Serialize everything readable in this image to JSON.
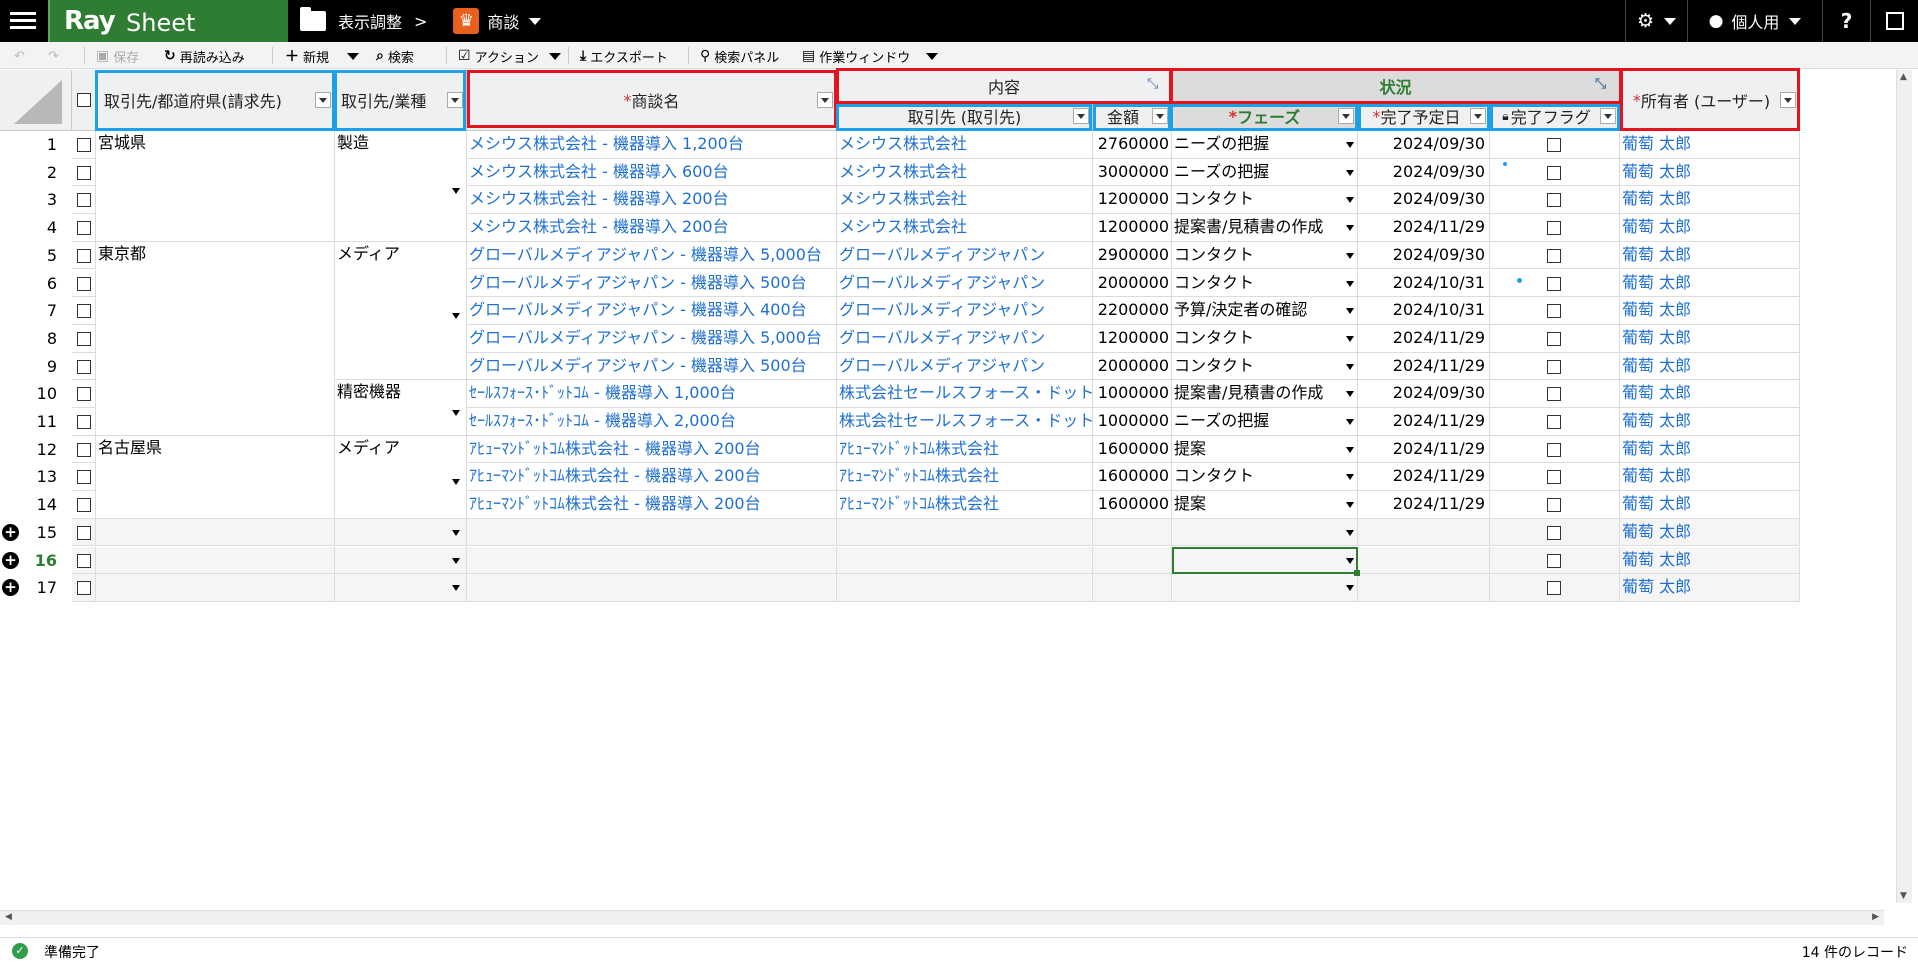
{
  "app": {
    "logo_main": "Ray",
    "logo_sub": "Sheet"
  },
  "breadcrumb": {
    "folder": "表示調整",
    "separator": ">",
    "page": "商談"
  },
  "topbar": {
    "user_label": "個人用",
    "help_label": "?"
  },
  "toolbar": {
    "save": "保存",
    "reload": "再読み込み",
    "new": "新規",
    "search": "検索",
    "action": "アクション",
    "export": "エクスポート",
    "search_panel": "検索パネル",
    "work_window": "作業ウィンドウ"
  },
  "headers": {
    "prefecture": "取引先/都道府県(請求先)",
    "industry": "取引先/業種",
    "deal_name": "商談名",
    "group_content": "内容",
    "account": "取引先 (取引先)",
    "amount": "金額",
    "group_status": "状況",
    "phase": "フェーズ",
    "due_date": "完了予定日",
    "done_flag": "完了フラグ",
    "owner": "所有者 (ユーザー)",
    "required_mark": "*"
  },
  "groups": [
    {
      "prefecture": "宮城県",
      "industries": [
        {
          "label": "製造",
          "rows": 4
        }
      ]
    },
    {
      "prefecture": "東京都",
      "industries": [
        {
          "label": "メディア",
          "rows": 5
        },
        {
          "label": "精密機器",
          "rows": 2
        }
      ]
    },
    {
      "prefecture": "名古屋県",
      "industries": [
        {
          "label": "メディア",
          "rows": 3
        }
      ]
    }
  ],
  "rows": [
    {
      "no": "1",
      "deal": "メシウス株式会社 - 機器導入 1,200台",
      "account": "メシウス株式会社",
      "amount": "2760000",
      "phase": "ニーズの把握",
      "due": "2024/09/30",
      "owner": "葡萄 太郎"
    },
    {
      "no": "2",
      "deal": "メシウス株式会社 - 機器導入 600台",
      "account": "メシウス株式会社",
      "amount": "3000000",
      "phase": "ニーズの把握",
      "due": "2024/09/30",
      "owner": "葡萄 太郎"
    },
    {
      "no": "3",
      "deal": "メシウス株式会社 - 機器導入 200台",
      "account": "メシウス株式会社",
      "amount": "1200000",
      "phase": "コンタクト",
      "due": "2024/09/30",
      "owner": "葡萄 太郎"
    },
    {
      "no": "4",
      "deal": "メシウス株式会社 - 機器導入 200台",
      "account": "メシウス株式会社",
      "amount": "1200000",
      "phase": "提案書/見積書の作成",
      "due": "2024/11/29",
      "owner": "葡萄 太郎"
    },
    {
      "no": "5",
      "deal": "グローバルメディアジャパン - 機器導入 5,000台",
      "account": "グローバルメディアジャパン",
      "amount": "2900000",
      "phase": "コンタクト",
      "due": "2024/09/30",
      "owner": "葡萄 太郎"
    },
    {
      "no": "6",
      "deal": "グローバルメディアジャパン - 機器導入 500台",
      "account": "グローバルメディアジャパン",
      "amount": "2000000",
      "phase": "コンタクト",
      "due": "2024/10/31",
      "owner": "葡萄 太郎"
    },
    {
      "no": "7",
      "deal": "グローバルメディアジャパン - 機器導入 400台",
      "account": "グローバルメディアジャパン",
      "amount": "2200000",
      "phase": "予算/決定者の確認",
      "due": "2024/10/31",
      "owner": "葡萄 太郎"
    },
    {
      "no": "8",
      "deal": "グローバルメディアジャパン - 機器導入 5,000台",
      "account": "グローバルメディアジャパン",
      "amount": "1200000",
      "phase": "コンタクト",
      "due": "2024/11/29",
      "owner": "葡萄 太郎"
    },
    {
      "no": "9",
      "deal": "グローバルメディアジャパン - 機器導入 500台",
      "account": "グローバルメディアジャパン",
      "amount": "2000000",
      "phase": "コンタクト",
      "due": "2024/11/29",
      "owner": "葡萄 太郎"
    },
    {
      "no": "10",
      "deal": "ｾｰﾙｽﾌｫｰｽ･ﾄﾞｯﾄｺﾑ - 機器導入 1,000台",
      "account": "株式会社セールスフォース・ドットコム",
      "amount": "1000000",
      "phase": "提案書/見積書の作成",
      "due": "2024/09/30",
      "owner": "葡萄 太郎"
    },
    {
      "no": "11",
      "deal": "ｾｰﾙｽﾌｫｰｽ･ﾄﾞｯﾄｺﾑ - 機器導入 2,000台",
      "account": "株式会社セールスフォース・ドットコム",
      "amount": "1000000",
      "phase": "ニーズの把握",
      "due": "2024/11/29",
      "owner": "葡萄 太郎"
    },
    {
      "no": "12",
      "deal": "ｱﾋｭｰﾏﾝﾄﾞｯﾄｺﾑ株式会社 - 機器導入 200台",
      "account": "ｱﾋｭｰﾏﾝﾄﾞｯﾄｺﾑ株式会社",
      "amount": "1600000",
      "phase": "提案",
      "due": "2024/11/29",
      "owner": "葡萄 太郎"
    },
    {
      "no": "13",
      "deal": "ｱﾋｭｰﾏﾝﾄﾞｯﾄｺﾑ株式会社 - 機器導入 200台",
      "account": "ｱﾋｭｰﾏﾝﾄﾞｯﾄｺﾑ株式会社",
      "amount": "1600000",
      "phase": "コンタクト",
      "due": "2024/11/29",
      "owner": "葡萄 太郎"
    },
    {
      "no": "14",
      "deal": "ｱﾋｭｰﾏﾝﾄﾞｯﾄｺﾑ株式会社 - 機器導入 200台",
      "account": "ｱﾋｭｰﾏﾝﾄﾞｯﾄｺﾑ株式会社",
      "amount": "1600000",
      "phase": "提案",
      "due": "2024/11/29",
      "owner": "葡萄 太郎"
    }
  ],
  "new_rows": [
    {
      "no": "15",
      "owner": "葡萄 太郎"
    },
    {
      "no": "16",
      "owner": "葡萄 太郎"
    },
    {
      "no": "17",
      "owner": "葡萄 太郎"
    }
  ],
  "status": {
    "ready": "準備完了",
    "count": "14 件のレコード"
  },
  "colors": {
    "logo_bg": "#2e7d32",
    "link": "#1f6fd1",
    "blue_frame": "#1ea0e6",
    "red_frame": "#e4141e",
    "status_ok": "#2e9e4a"
  }
}
